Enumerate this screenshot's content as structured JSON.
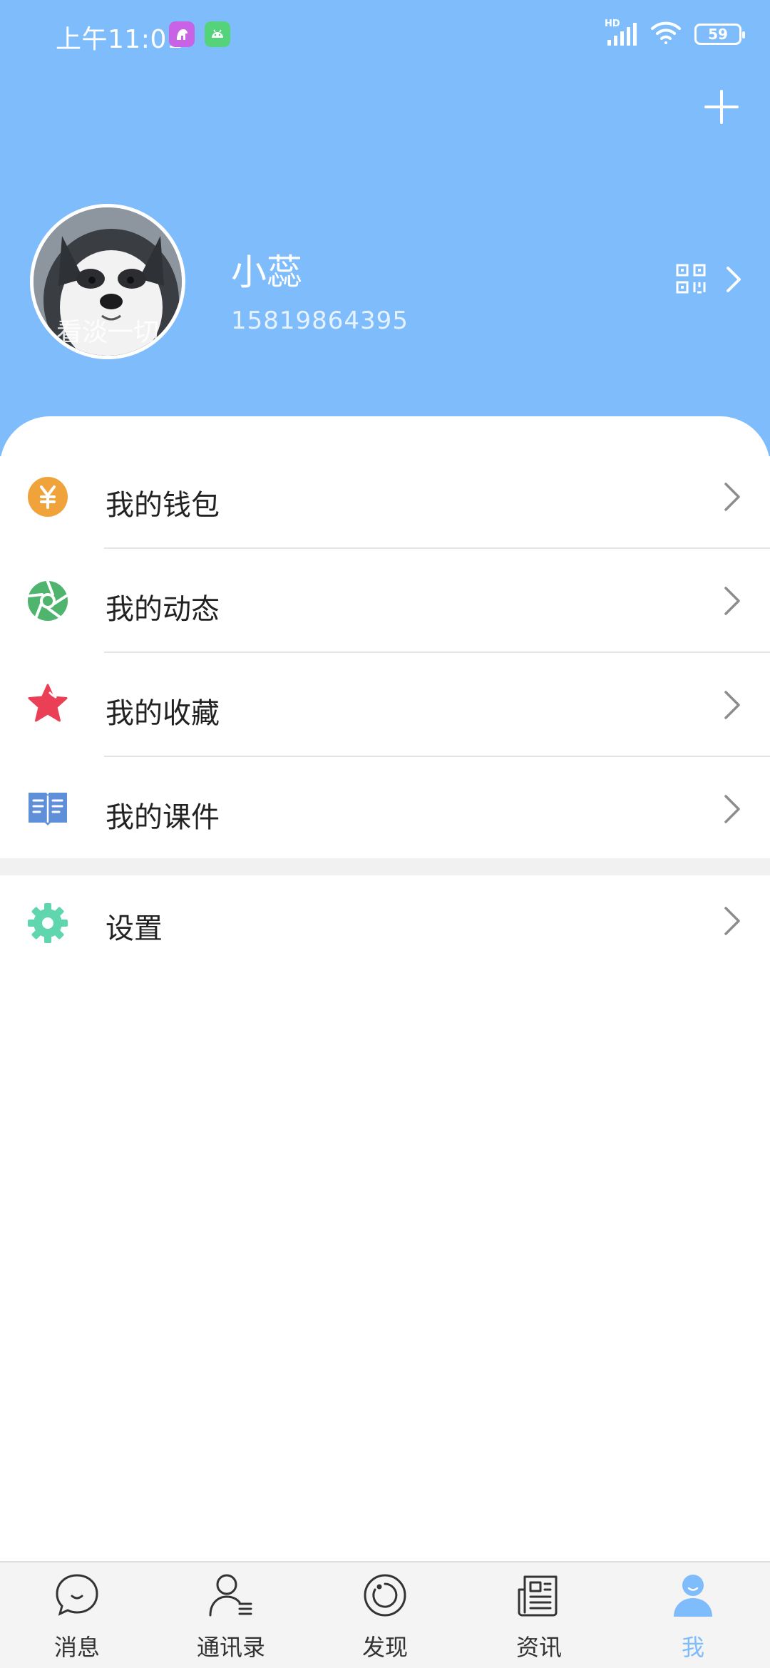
{
  "status_bar": {
    "time": "上午11:01",
    "network_label": "HD",
    "battery": "59"
  },
  "profile": {
    "name": "小蕊",
    "phone": "15819864395",
    "avatar_caption": "看淡一切"
  },
  "menu": {
    "items": [
      {
        "label": "我的钱包",
        "icon": "wallet-yen-icon"
      },
      {
        "label": "我的动态",
        "icon": "aperture-icon"
      },
      {
        "label": "我的收藏",
        "icon": "star-icon"
      },
      {
        "label": "我的课件",
        "icon": "book-icon"
      }
    ],
    "settings": {
      "label": "设置",
      "icon": "gear-icon"
    }
  },
  "bottom_nav": {
    "items": [
      {
        "label": "消息",
        "icon": "chat-bubble-icon"
      },
      {
        "label": "通讯录",
        "icon": "contacts-icon"
      },
      {
        "label": "发现",
        "icon": "compass-icon"
      },
      {
        "label": "资讯",
        "icon": "news-icon"
      },
      {
        "label": "我",
        "icon": "person-icon"
      }
    ],
    "active": "我"
  },
  "colors": {
    "header": "#7fbcfc",
    "wallet": "#f0a23b",
    "moments": "#4fb56e",
    "favorites": "#ea3f55",
    "courseware": "#5f8fd8",
    "settings": "#5fd6ad",
    "active_tab": "#7fbcfc"
  }
}
